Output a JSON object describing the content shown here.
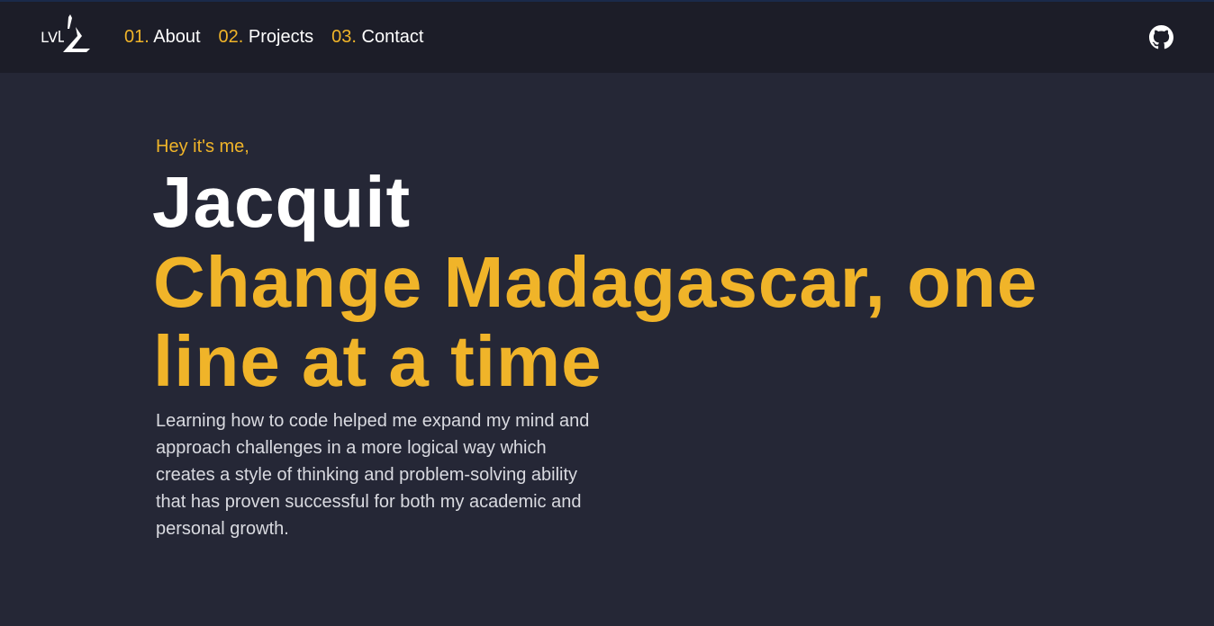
{
  "nav": {
    "logo_text": "LVJZ",
    "links": [
      {
        "num": "01.",
        "label": "About"
      },
      {
        "num": "02.",
        "label": "Projects"
      },
      {
        "num": "03.",
        "label": "Contact"
      }
    ],
    "github_icon": "github-icon"
  },
  "hero": {
    "greeting": "Hey it's me,",
    "name": "Jacquit",
    "tagline": "Change Madagascar, one line at a time",
    "bio": "Learning how to code helped me expand my mind and approach challenges in a more logical way which creates a style of thinking and problem-solving ability that has proven successful for both my academic and personal growth."
  },
  "colors": {
    "accent": "#f0b429",
    "nav_bg": "#1c1d28",
    "page_bg": "#252736",
    "text": "#ffffff"
  }
}
